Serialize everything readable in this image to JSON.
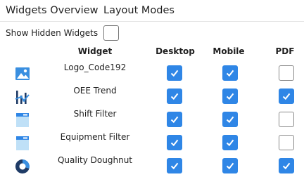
{
  "tabs": [
    {
      "label": "Widgets Overview",
      "active": true
    },
    {
      "label": "Layout Modes",
      "active": false
    }
  ],
  "show_hidden": {
    "label": "Show Hidden Widgets",
    "checked": false
  },
  "columns": {
    "widget": "Widget",
    "desktop": "Desktop",
    "mobile": "Mobile",
    "pdf": "PDF"
  },
  "colors": {
    "accent": "#2f86e6",
    "tab_active": "#2f86d8"
  },
  "widgets": [
    {
      "name": "Logo_Code192",
      "icon": "image-icon",
      "desktop": true,
      "mobile": true,
      "pdf": false
    },
    {
      "name": "OEE Trend",
      "icon": "trend-chart-icon",
      "desktop": true,
      "mobile": true,
      "pdf": true
    },
    {
      "name": "Shift Filter",
      "icon": "filter-panel-icon",
      "desktop": true,
      "mobile": true,
      "pdf": false
    },
    {
      "name": "Equipment Filter",
      "icon": "filter-panel-icon",
      "desktop": true,
      "mobile": true,
      "pdf": false
    },
    {
      "name": "Quality Doughnut",
      "icon": "doughnut-chart-icon",
      "desktop": true,
      "mobile": true,
      "pdf": true
    }
  ]
}
